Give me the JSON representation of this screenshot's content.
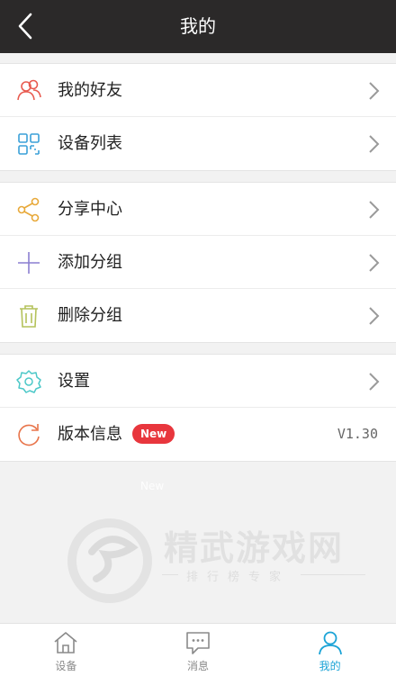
{
  "header": {
    "title": "我的",
    "back_icon": "chevron-left-icon"
  },
  "groups": [
    {
      "items": [
        {
          "label": "我的好友",
          "icon": "friends-icon",
          "color": "#e85a4f"
        },
        {
          "label": "设备列表",
          "icon": "grid-icon",
          "color": "#3aa0d8"
        }
      ]
    },
    {
      "items": [
        {
          "label": "分享中心",
          "icon": "share-icon",
          "color": "#e8a93a"
        },
        {
          "label": "添加分组",
          "icon": "plus-icon",
          "color": "#8a7fd0"
        },
        {
          "label": "删除分组",
          "icon": "trash-icon",
          "color": "#b4c25a"
        }
      ]
    },
    {
      "items": [
        {
          "label": "设置",
          "icon": "gear-icon",
          "color": "#4cc8c8"
        },
        {
          "label": "版本信息",
          "icon": "refresh-icon",
          "color": "#e8744a",
          "badge": "New",
          "value": "V1.30"
        }
      ]
    }
  ],
  "ghost_badge": "New",
  "watermark": {
    "title": "精武游戏网",
    "subtitle": "排行榜专家"
  },
  "tabs": [
    {
      "label": "设备",
      "icon": "home-icon",
      "active": false
    },
    {
      "label": "消息",
      "icon": "message-icon",
      "active": false
    },
    {
      "label": "我的",
      "icon": "user-icon",
      "active": true
    }
  ],
  "colors": {
    "header_bg": "#2b2929",
    "active_tab": "#1aa3d6",
    "badge": "#e8363d"
  }
}
